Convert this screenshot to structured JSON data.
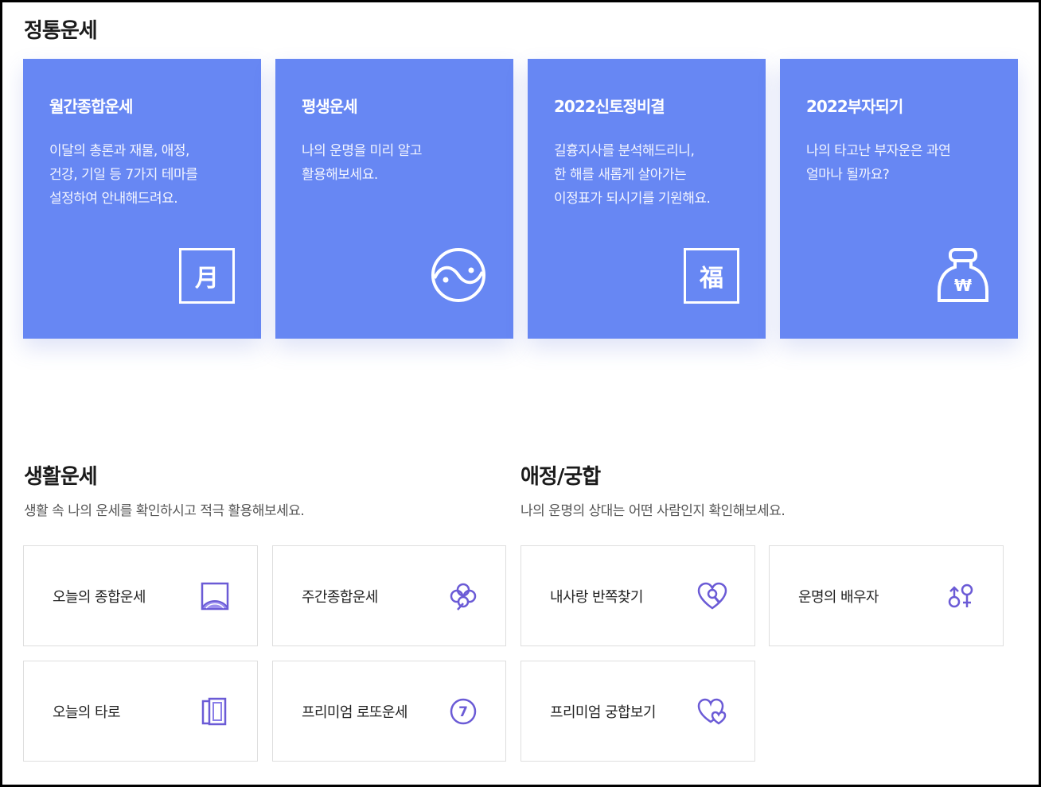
{
  "traditional": {
    "title": "정통운세",
    "cards": [
      {
        "title": "월간종합운세",
        "desc": "이달의 총론과 재물, 애정,\n건강, 기일 등 7가지 테마를\n설정하여 안내해드려요.",
        "icon": "calendar-month-icon",
        "glyph": "月"
      },
      {
        "title": "평생운세",
        "desc": "나의 운명을 미리 알고\n활용해보세요.",
        "icon": "yin-yang-icon"
      },
      {
        "title": "2022신토정비결",
        "desc": "길흉지사를 분석해드리니,\n한 해를 새롭게 살아가는\n이정표가 되시기를 기원해요.",
        "icon": "fortune-hanja-icon",
        "glyph": "福"
      },
      {
        "title": "2022부자되기",
        "desc": "나의 타고난 부자운은 과연\n얼마나 될까요?",
        "icon": "money-bag-icon",
        "glyph": "₩"
      }
    ]
  },
  "life": {
    "title": "생활운세",
    "desc": "생활 속 나의 운세를 확인하시고 적극 활용해보세요.",
    "items": [
      {
        "label": "오늘의 종합운세",
        "icon": "sunrise-icon"
      },
      {
        "label": "주간종합운세",
        "icon": "clover-icon"
      },
      {
        "label": "오늘의 타로",
        "icon": "tarot-cards-icon"
      },
      {
        "label": "프리미엄 로또운세",
        "icon": "lotto-ball-icon",
        "glyph": "7"
      }
    ]
  },
  "love": {
    "title": "애정/궁합",
    "desc": "나의 운명의 상대는 어떤 사람인지 확인해보세요.",
    "items": [
      {
        "label": "내사랑 반쪽찾기",
        "icon": "heart-search-icon"
      },
      {
        "label": "운명의 배우자",
        "icon": "gender-symbols-icon"
      },
      {
        "label": "프리미엄 궁합보기",
        "icon": "double-heart-icon"
      }
    ]
  },
  "colors": {
    "card_bg": "#6787f3",
    "icon_accent": "#6b5bd6"
  }
}
